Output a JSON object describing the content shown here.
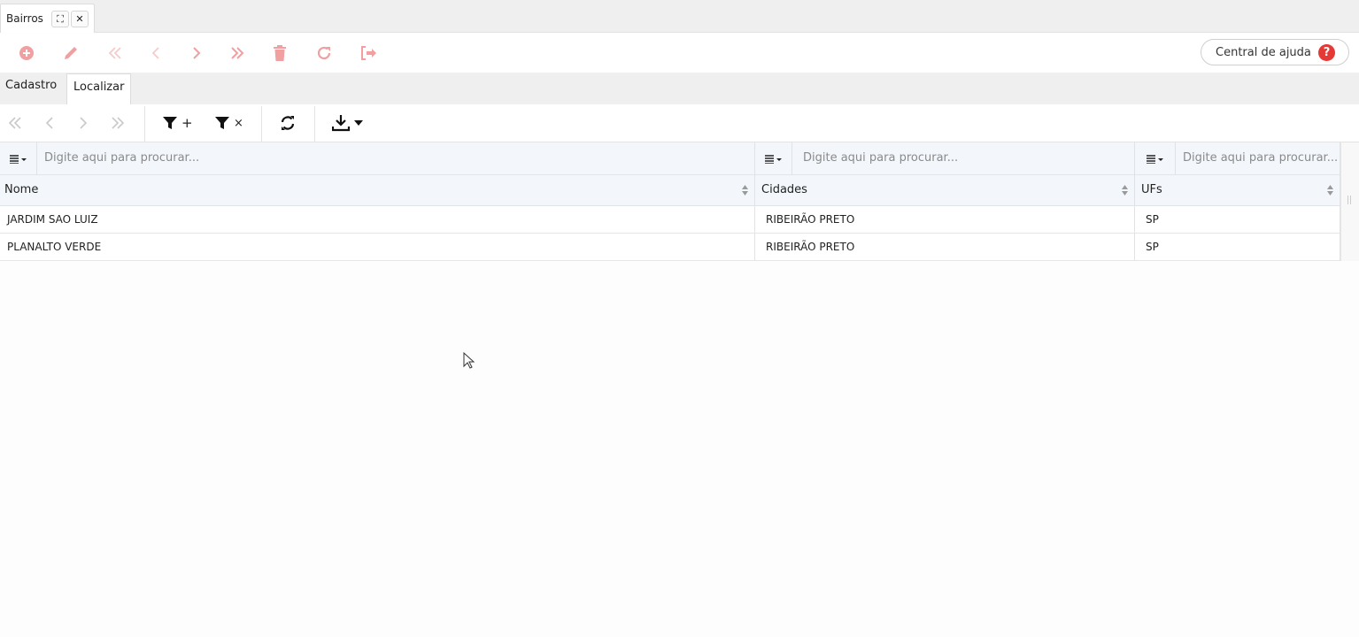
{
  "window_tab": {
    "title": "Bairros",
    "maximize_glyph": "⛶",
    "close_glyph": "✕"
  },
  "toolbar": {
    "icons": [
      "add-circle-icon",
      "pencil-icon",
      "double-chevron-left-icon",
      "chevron-left-icon",
      "chevron-right-icon",
      "double-chevron-right-icon",
      "trash-icon",
      "refresh-icon",
      "exit-icon"
    ],
    "accent_color": "#f0a0a0",
    "help_label": "Central de ajuda",
    "help_glyph": "?",
    "help_color": "#e53935"
  },
  "subtabs": [
    {
      "label": "Cadastro",
      "active": false
    },
    {
      "label": "Localizar",
      "active": true
    }
  ],
  "navbar": {
    "icons": [
      "double-chevron-left-icon",
      "chevron-left-icon",
      "chevron-right-icon",
      "double-chevron-right-icon",
      "filter-add-icon",
      "filter-clear-icon",
      "sync-icon",
      "download-icon"
    ],
    "filter_add_suffix": "+",
    "filter_clear_suffix": "×"
  },
  "grid": {
    "search_placeholder": "Digite aqui para procurar...",
    "columns": [
      "Nome",
      "Cidades",
      "UFs"
    ],
    "rows": [
      [
        "JARDIM SAO LUIZ",
        "RIBEIRÃO PRETO",
        "SP"
      ],
      [
        "PLANALTO VERDE",
        "RIBEIRÃO PRETO",
        "SP"
      ]
    ]
  }
}
